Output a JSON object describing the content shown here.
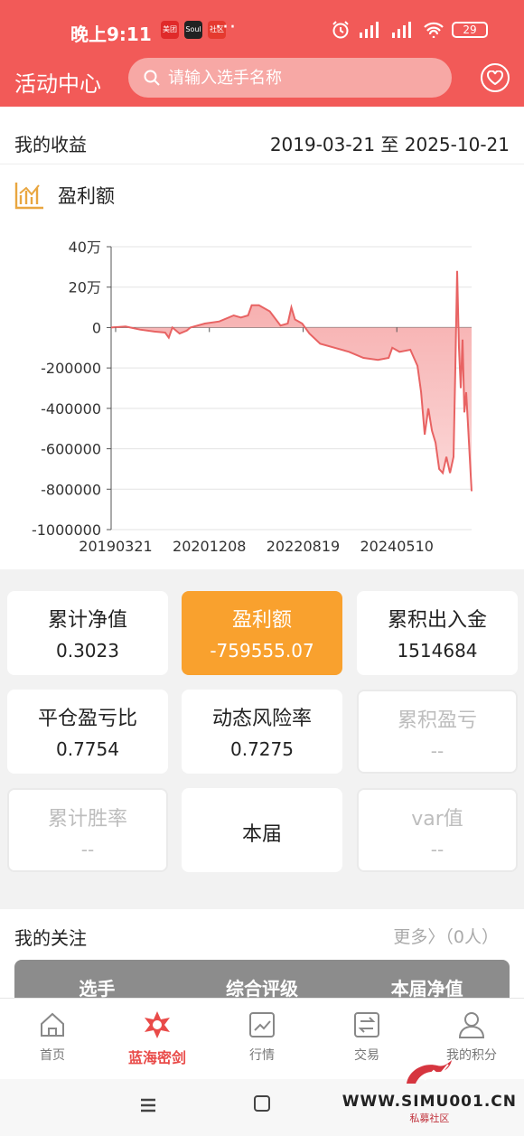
{
  "status": {
    "time": "晚上9:11",
    "battery": "29",
    "app_icons": [
      {
        "label": "美团",
        "color": "#e02a2a"
      },
      {
        "label": "Soul",
        "color": "#222222"
      },
      {
        "label": "社区",
        "color": "#e53a2f"
      }
    ],
    "dots": "···"
  },
  "header": {
    "title": "活动中心",
    "search_placeholder": "请输入选手名称"
  },
  "earnings": {
    "label": "我的收益",
    "date_range": "2019-03-21 至 2025-10-21"
  },
  "metric": {
    "title": "盈利额"
  },
  "chart_data": {
    "type": "area",
    "y_tick_labels": [
      "40万",
      "20万",
      "0",
      "-200000",
      "-400000",
      "-600000",
      "-800000",
      "-1000000"
    ],
    "y_ticks": [
      400000,
      200000,
      0,
      -200000,
      -400000,
      -600000,
      -800000,
      -1000000
    ],
    "ylim": [
      -1000000,
      400000
    ],
    "x_tick_labels": [
      "20190321",
      "20201208",
      "20220819",
      "20240510"
    ],
    "x_tick_positions": [
      0.0,
      0.26,
      0.52,
      0.78
    ],
    "series": [
      {
        "color": "#e86363",
        "points": [
          [
            0.0,
            0
          ],
          [
            0.04,
            5000
          ],
          [
            0.08,
            -10000
          ],
          [
            0.12,
            -20000
          ],
          [
            0.15,
            -25000
          ],
          [
            0.16,
            -50000
          ],
          [
            0.17,
            0
          ],
          [
            0.19,
            -30000
          ],
          [
            0.21,
            -15000
          ],
          [
            0.22,
            0
          ],
          [
            0.26,
            20000
          ],
          [
            0.3,
            30000
          ],
          [
            0.34,
            60000
          ],
          [
            0.36,
            50000
          ],
          [
            0.38,
            60000
          ],
          [
            0.39,
            110000
          ],
          [
            0.41,
            110000
          ],
          [
            0.44,
            80000
          ],
          [
            0.47,
            10000
          ],
          [
            0.49,
            20000
          ],
          [
            0.5,
            100000
          ],
          [
            0.51,
            40000
          ],
          [
            0.53,
            20000
          ],
          [
            0.55,
            -30000
          ],
          [
            0.58,
            -80000
          ],
          [
            0.62,
            -100000
          ],
          [
            0.66,
            -120000
          ],
          [
            0.7,
            -150000
          ],
          [
            0.74,
            -160000
          ],
          [
            0.77,
            -150000
          ],
          [
            0.78,
            -100000
          ],
          [
            0.8,
            -120000
          ],
          [
            0.83,
            -110000
          ],
          [
            0.85,
            -190000
          ],
          [
            0.86,
            -320000
          ],
          [
            0.87,
            -530000
          ],
          [
            0.88,
            -400000
          ],
          [
            0.89,
            -510000
          ],
          [
            0.9,
            -570000
          ],
          [
            0.91,
            -700000
          ],
          [
            0.92,
            -720000
          ],
          [
            0.93,
            -640000
          ],
          [
            0.94,
            -720000
          ],
          [
            0.95,
            -640000
          ],
          [
            0.955,
            -200000
          ],
          [
            0.96,
            280000
          ],
          [
            0.965,
            -100000
          ],
          [
            0.97,
            -300000
          ],
          [
            0.975,
            -60000
          ],
          [
            0.98,
            -420000
          ],
          [
            0.985,
            -320000
          ],
          [
            0.99,
            -480000
          ],
          [
            1.0,
            -810000
          ]
        ]
      }
    ],
    "grid": true,
    "legend": "none"
  },
  "stats": [
    {
      "label": "累计净值",
      "value": "0.3023",
      "state": "normal"
    },
    {
      "label": "盈利额",
      "value": "-759555.07",
      "state": "active"
    },
    {
      "label": "累积出入金",
      "value": "1514684",
      "state": "normal"
    },
    {
      "label": "平仓盈亏比",
      "value": "0.7754",
      "state": "normal"
    },
    {
      "label": "动态风险率",
      "value": "0.7275",
      "state": "normal"
    },
    {
      "label": "累积盈亏",
      "value": "--",
      "state": "disabled"
    },
    {
      "label": "累计胜率",
      "value": "--",
      "state": "disabled"
    },
    {
      "label": "本届",
      "value": "",
      "state": "center"
    },
    {
      "label": "var值",
      "value": "--",
      "state": "disabled"
    }
  ],
  "follow": {
    "title": "我的关注",
    "more": "更多〉（0人）",
    "columns": [
      "选手",
      "综合评级",
      "本届净值"
    ]
  },
  "tabs": [
    {
      "label": "首页",
      "icon": "home-icon"
    },
    {
      "label": "蓝海密剑",
      "icon": "emblem-icon"
    },
    {
      "label": "行情",
      "icon": "chart-icon"
    },
    {
      "label": "交易",
      "icon": "exchange-icon"
    },
    {
      "label": "我的积分",
      "icon": "user-icon"
    }
  ],
  "watermark": {
    "site": "WWW.SIMU001.CN",
    "sub": "私募社区"
  },
  "colors": {
    "header": "#f25a58",
    "active_card": "#f9a12e",
    "chart_line": "#e86363",
    "tab_active": "#e94b49"
  }
}
